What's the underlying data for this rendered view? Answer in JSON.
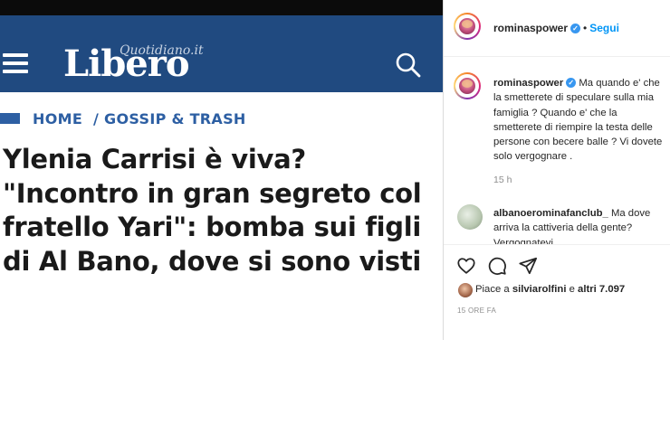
{
  "article": {
    "logo_main": "Libero",
    "logo_sub": "Quotidiano.it",
    "breadcrumb": [
      "HOME",
      "/ GOSSIP & TRASH"
    ],
    "headline": "Ylenia Carrisi è viva? \"Incontro in gran segreto col fratello Yari\": bomba sui figli di Al Bano, dove si sono visti",
    "colors": {
      "header": "#204a80",
      "accent": "#2d5fa3"
    },
    "icons": [
      "menu-icon",
      "search-icon"
    ]
  },
  "instagram": {
    "username": "rominaspower",
    "follow_label": "Segui",
    "caption_user": "rominaspower",
    "caption_text": "Ma quando e' che la smetterete di speculare sulla mia famiglia ? Quando e' che la smetterete di riempire la testa delle persone con becere balle ? Vi dovete solo vergognare .",
    "caption_time": "15 h",
    "comment_user": "albanoerominafanclub_",
    "comment_text": "Ma dove arriva la cattiveria della gente? Vergognatevi",
    "likes_prefix": "Piace a",
    "likes_user": "silviarolfini",
    "likes_middle": "e",
    "likes_count": "altri 7.097",
    "post_time": "15 ORE FA",
    "colors": {
      "link": "#0095f6",
      "verified": "#3897f0",
      "muted": "#8e8e8e"
    },
    "icons": [
      "heart-icon",
      "comment-icon",
      "share-icon",
      "verified-icon"
    ]
  }
}
